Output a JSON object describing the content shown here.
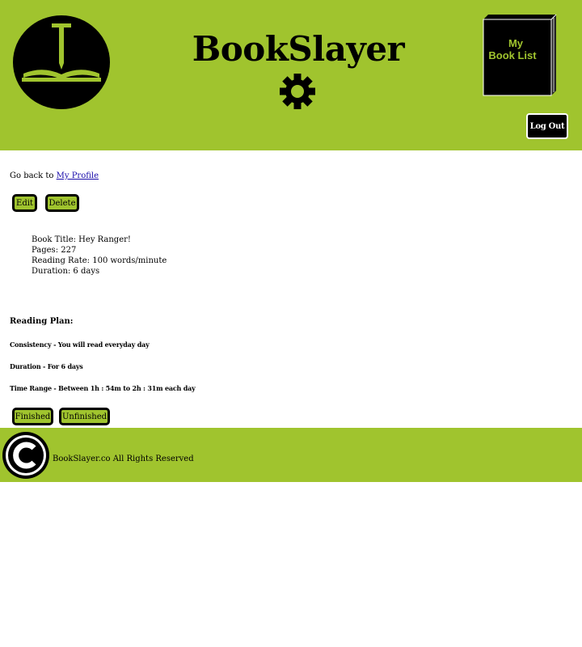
{
  "header": {
    "brand": "BookSlayer",
    "book_list_label_line1": "My",
    "book_list_label_line2": "Book List",
    "logout_label": "Log Out"
  },
  "main": {
    "back_prefix": "Go back to",
    "back_link": "My Profile",
    "edit_label": "Edit",
    "delete_label": "Delete",
    "book": {
      "title": "Book Title: Hey Ranger!",
      "pages": "Pages: 227",
      "rate": "Reading Rate: 100 words/minute",
      "duration": "Duration: 6 days"
    },
    "plan": {
      "heading": "Reading Plan:",
      "consistency": "Consistency - You will read everyday day",
      "duration": "Duration - For 6 days",
      "time_range": "Time Range - Between 1h : 54m to 2h : 31m each day"
    },
    "finished_label": "Finished",
    "unfinished_label": "Unfinished"
  },
  "footer": {
    "text": "BookSlayer.co All Rights Reserved"
  },
  "colors": {
    "brand_green": "#a0c42e",
    "book_text_green": "#a0c42e",
    "dark": "#000000"
  }
}
